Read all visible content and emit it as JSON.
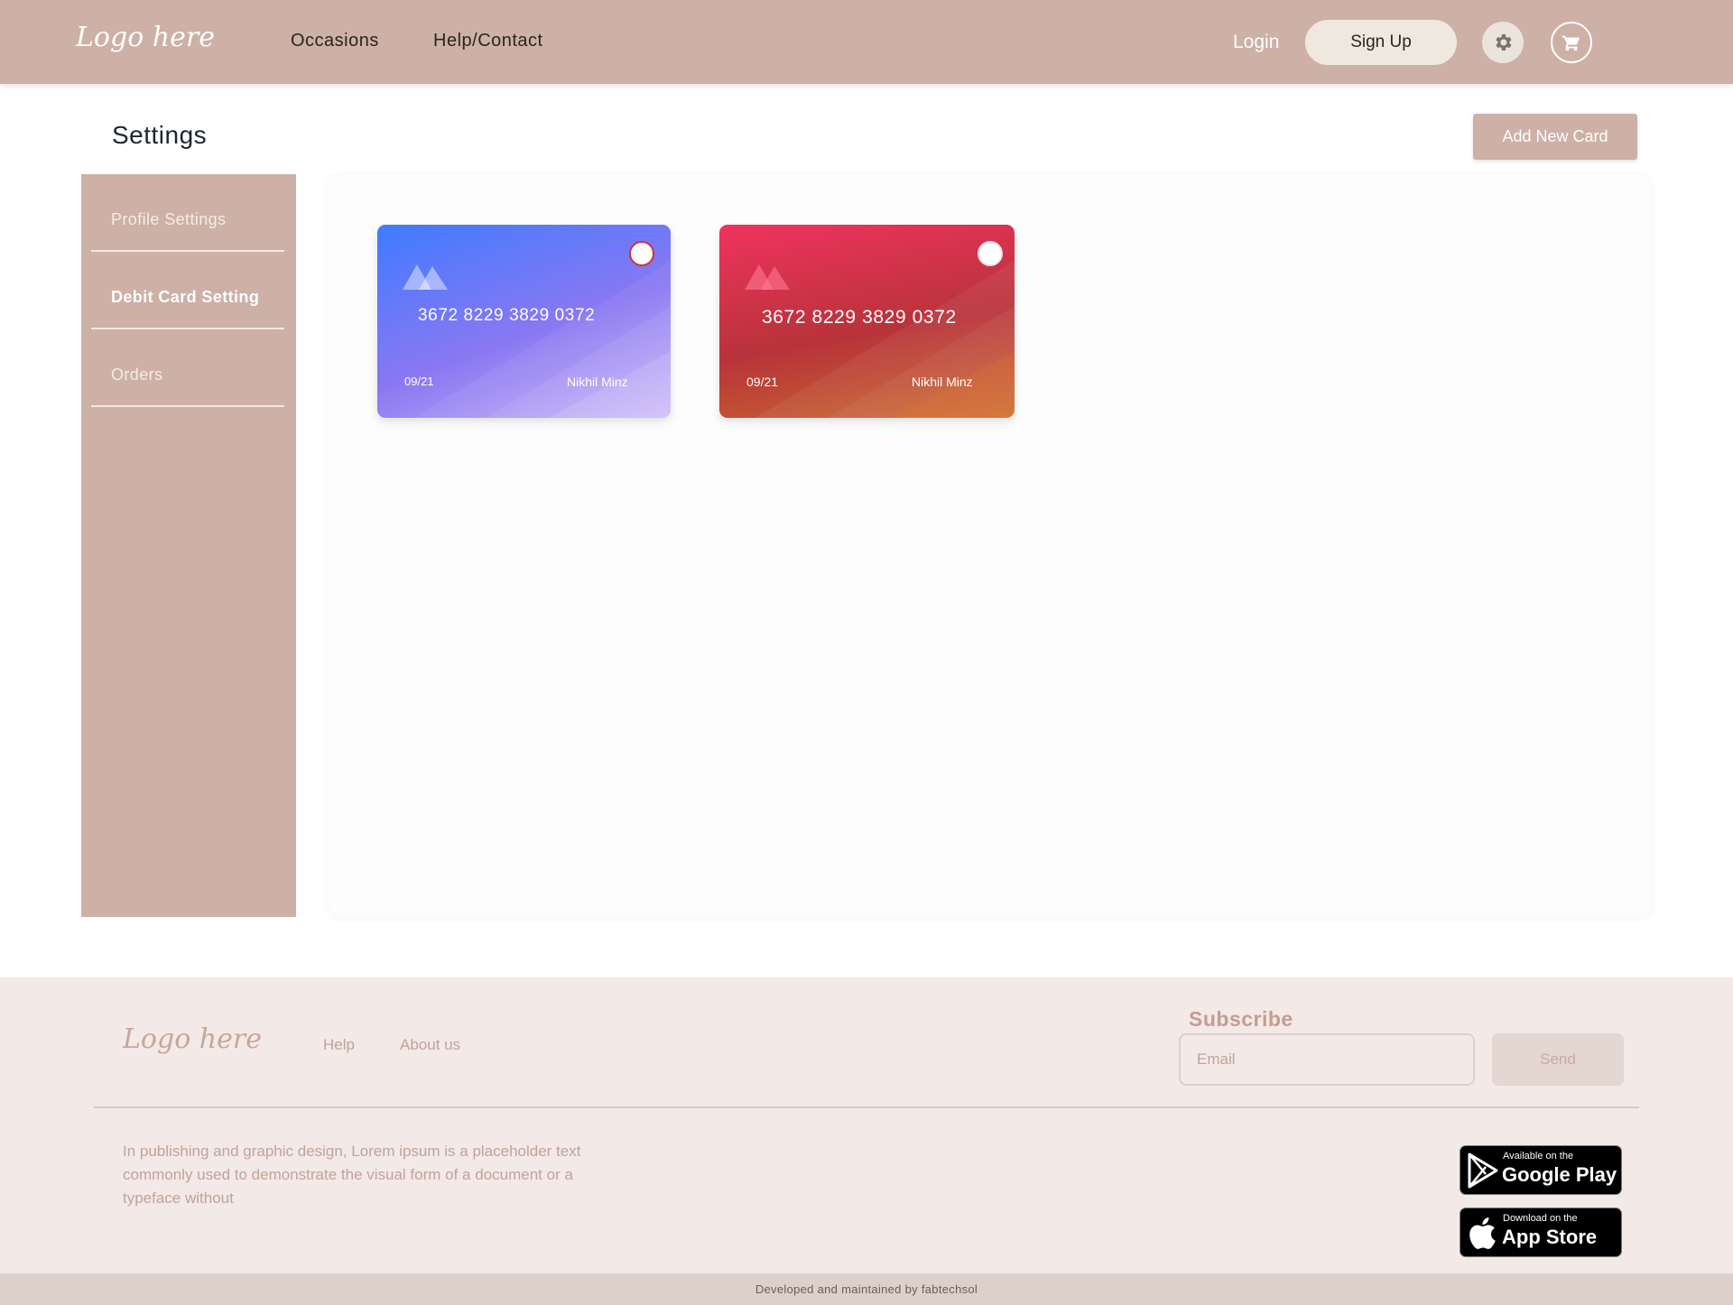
{
  "header": {
    "logo": "Logo here",
    "nav": [
      "Occasions",
      "Help/Contact"
    ],
    "login": "Login",
    "signup": "Sign Up"
  },
  "page": {
    "title": "Settings",
    "add_card_label": "Add New Card"
  },
  "sidebar": {
    "items": [
      {
        "label": "Profile Settings",
        "active": false
      },
      {
        "label": "Debit Card Setting",
        "active": true
      },
      {
        "label": "Orders",
        "active": false
      }
    ]
  },
  "cards": [
    {
      "number": "3672 8229 3829 0372",
      "expiry": "09/21",
      "holder": "Nikhil Minz",
      "theme": "blue",
      "selected": false
    },
    {
      "number": "3672 8229 3829 0372",
      "expiry": "09/21",
      "holder": "Nikhil Minz",
      "theme": "red",
      "selected": false
    }
  ],
  "footer": {
    "logo": "Logo here",
    "links": [
      "Help",
      "About us"
    ],
    "subscribe_title": "Subscribe",
    "email_placeholder": "Email",
    "send_label": "Send",
    "description": "In publishing and graphic design, Lorem ipsum is a placeholder text commonly used to demonstrate the visual form of a document or a typeface without",
    "google_play": {
      "small": "Available on the",
      "big": "Google Play"
    },
    "app_store": {
      "small": "Download on the",
      "big": "App Store"
    },
    "credit": "Developed and maintained by fabtechsol"
  },
  "colors": {
    "brand": "#cdb0a6",
    "footer_bg": "#f3e9e6",
    "signup_bg": "#efe8df"
  },
  "icons": [
    "gear-icon",
    "cart-icon",
    "mountain-logo-icon",
    "google-play-icon",
    "apple-icon"
  ]
}
